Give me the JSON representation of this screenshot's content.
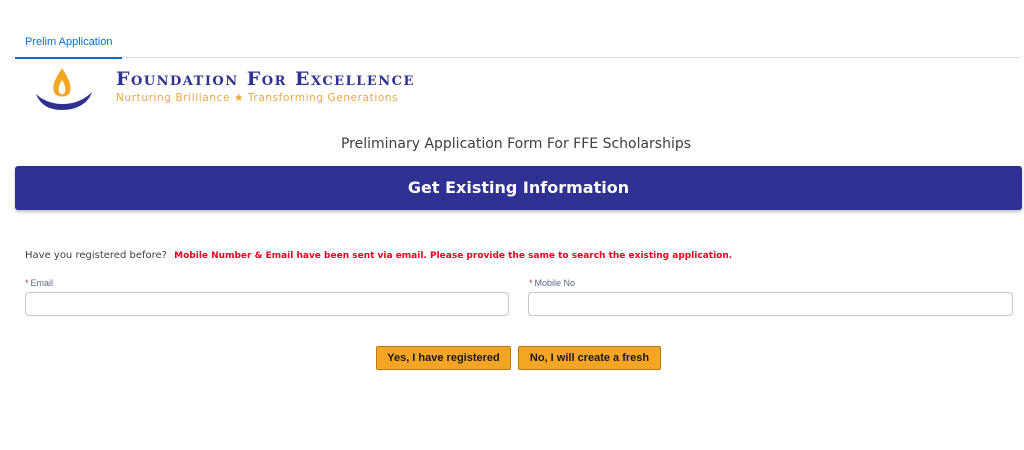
{
  "tabs": [
    {
      "label": "Prelim Application",
      "active": true
    }
  ],
  "logo": {
    "title": "Foundation For Excellence",
    "tagline_left": "Nurturing Brilliance",
    "tagline_right": "Transforming Generations",
    "star": "★"
  },
  "form": {
    "title": "Preliminary Application Form For FFE Scholarships",
    "banner": "Get Existing Information",
    "question": "Have you registered before?",
    "note": "Mobile Number & Email have been sent via email. Please provide the same to search the existing application.",
    "required_mark": "*",
    "email_label": "Email",
    "email_value": "",
    "mobile_label": "Mobile No",
    "mobile_value": ""
  },
  "buttons": {
    "registered": "Yes, I have registered",
    "fresh": "No, I will create a fresh"
  },
  "colors": {
    "brand_blue": "#2e3192",
    "brand_orange": "#f2a54a",
    "button_orange": "#f5a524",
    "link_blue": "#0070d2",
    "error_red": "#ea001e"
  }
}
